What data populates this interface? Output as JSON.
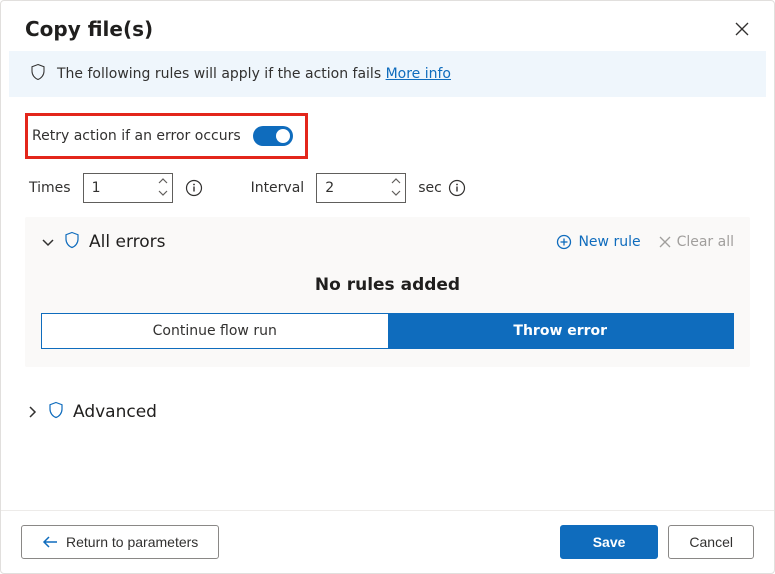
{
  "dialog": {
    "title": "Copy file(s)",
    "banner_text": "The following rules will apply if the action fails",
    "more_info": "More info"
  },
  "retry": {
    "label": "Retry action if an error occurs",
    "enabled": true,
    "times_label": "Times",
    "times_value": "1",
    "interval_label": "Interval",
    "interval_value": "2",
    "interval_unit": "sec"
  },
  "errors": {
    "section_title": "All errors",
    "new_rule": "New rule",
    "clear_all": "Clear all",
    "empty_text": "No rules added",
    "continue_label": "Continue flow run",
    "throw_label": "Throw error",
    "selected": "throw"
  },
  "advanced": {
    "title": "Advanced"
  },
  "footer": {
    "return": "Return to parameters",
    "save": "Save",
    "cancel": "Cancel"
  }
}
